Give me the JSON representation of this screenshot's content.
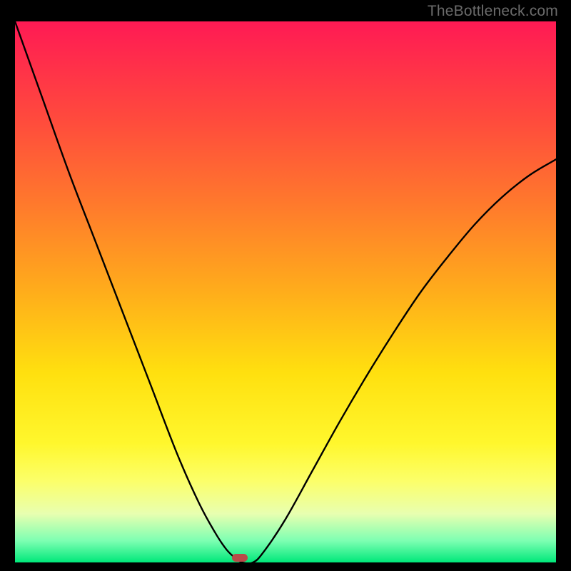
{
  "watermark": "TheBottleneck.com",
  "marker": {
    "x_frac": 0.415,
    "y_frac": 0.992,
    "w": 22,
    "h": 11
  },
  "chart_data": {
    "type": "line",
    "title": "",
    "xlabel": "",
    "ylabel": "",
    "xlim": [
      0,
      1
    ],
    "ylim": [
      0,
      1
    ],
    "notes": "Axes are unlabeled. x is normalized horizontal position (0=left, 1=right). y is normalized vertical position of curve measured from bottom (0=bottom/green, 1=top/red). Background is a vertical gradient from red (top) through orange/yellow to green (bottom). Minimum of the curve (y≈0) occurs near x≈0.40–0.44, marked with a small dark-red rounded rectangle.",
    "series": [
      {
        "name": "curve",
        "x": [
          0.0,
          0.05,
          0.1,
          0.15,
          0.2,
          0.25,
          0.3,
          0.34,
          0.37,
          0.39,
          0.405,
          0.42,
          0.44,
          0.46,
          0.5,
          0.55,
          0.6,
          0.65,
          0.7,
          0.75,
          0.8,
          0.85,
          0.9,
          0.95,
          1.0
        ],
        "y": [
          1.0,
          0.86,
          0.72,
          0.59,
          0.46,
          0.33,
          0.2,
          0.11,
          0.055,
          0.025,
          0.01,
          0.0,
          0.0,
          0.02,
          0.08,
          0.17,
          0.26,
          0.345,
          0.425,
          0.5,
          0.565,
          0.625,
          0.675,
          0.715,
          0.745
        ]
      }
    ],
    "marker_point": {
      "x": 0.43,
      "y": 0.0
    }
  }
}
